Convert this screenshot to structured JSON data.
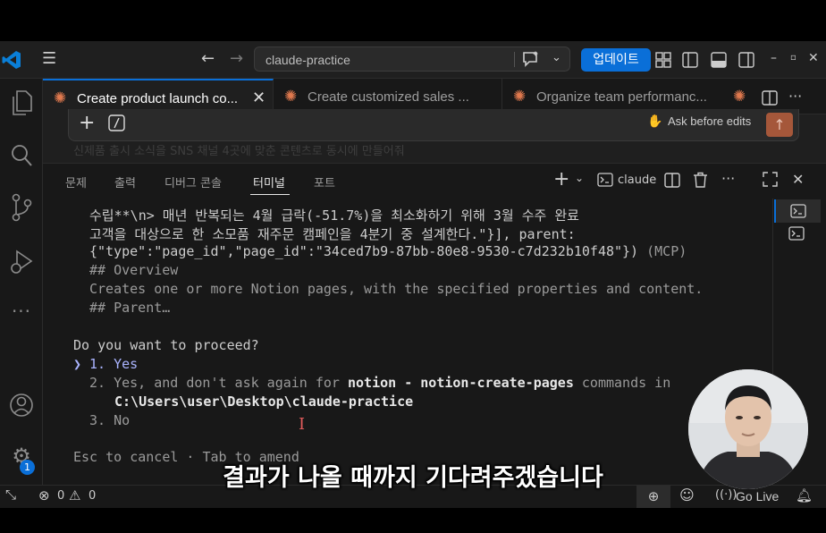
{
  "titlebar": {
    "search_text": "claude-practice",
    "update_label": "업데이트"
  },
  "tabs": [
    {
      "label": "Create product launch co...",
      "active": true
    },
    {
      "label": "Create customized sales ...",
      "active": false
    },
    {
      "label": "Organize team performanc...",
      "active": false
    }
  ],
  "chat": {
    "ask_label": "Ask before edits",
    "faded_text": "신제품 출시 소식을 SNS 채널 4곳에 맞춘 콘텐츠로 동시에 만들어줘"
  },
  "panel": {
    "tabs": [
      "문제",
      "출력",
      "디버그 콘솔",
      "터미널",
      "포트"
    ],
    "active_tab": "터미널",
    "terminal_name": "claude"
  },
  "terminal": {
    "line1": "수립**\\n> 매년 반복되는 4월 급락(-51.7%)을 최소화하기 위해 3월 수주 완료",
    "line2": "고객을 대상으로 한 소모품 재주문 캠페인을 4분기 중 설계한다.\"}], parent:",
    "line3a": "{\"type\":\"page_id\",\"page_id\":\"34ced7b9-87bb-80e8-9530-c7d232b10f48\"})",
    "line3b": " (MCP)",
    "line4": "## Overview",
    "line5": "Creates one or more Notion pages, with the specified properties and content.",
    "line6": "## Parent…",
    "question": "Do you want to proceed?",
    "opt1_marker": "❯",
    "opt1": "1. Yes",
    "opt2a": "2. Yes, and don't ask again for ",
    "opt2b": "notion - notion-create-pages",
    "opt2c": " commands in",
    "opt2d": "C:\\Users\\user\\Desktop\\claude-practice",
    "opt3": "3. No",
    "footer": "Esc to cancel · Tab to amend"
  },
  "statusbar": {
    "errors": "0",
    "warnings": "0",
    "golive": "Go Live"
  },
  "activity": {
    "badge": "1"
  },
  "subtitle": "결과가 나올 때까지 기다려주겠습니다"
}
